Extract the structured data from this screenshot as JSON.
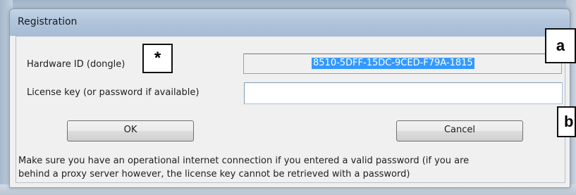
{
  "dialog": {
    "title": "Registration",
    "hardware_id": {
      "label": "Hardware ID (dongle)",
      "value": "8510-5DFF-15DC-9CED-F79A-1815"
    },
    "license_key": {
      "label": "License key (or password if available)",
      "value": ""
    },
    "buttons": {
      "ok": "OK",
      "cancel": "Cancel"
    },
    "note": {
      "line1": "Make sure you have an operational internet connection if you entered a valid password (if you are",
      "line2": "behind a proxy server however, the license key cannot be retrieved with a password)"
    }
  },
  "annotations": {
    "star": "*",
    "a": "a",
    "b": "b"
  }
}
